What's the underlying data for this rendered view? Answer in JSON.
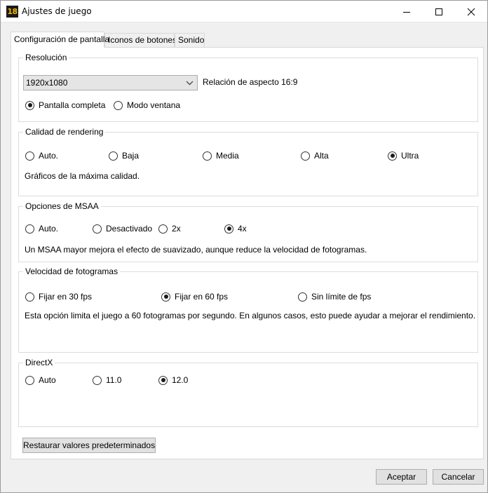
{
  "window": {
    "app_icon_text": "18",
    "title": "Ajustes de juego"
  },
  "tabs": [
    {
      "label": "Configuración de pantalla",
      "active": true
    },
    {
      "label": "Iconos de botones",
      "active": false
    },
    {
      "label": "Sonido",
      "active": false
    }
  ],
  "resolution": {
    "title": "Resolución",
    "selected": "1920x1080",
    "aspect_label": "Relación de aspecto 16:9",
    "modes": [
      {
        "label": "Pantalla completa",
        "checked": true
      },
      {
        "label": "Modo ventana",
        "checked": false
      }
    ]
  },
  "rendering": {
    "title": "Calidad de rendering",
    "options": [
      {
        "label": "Auto.",
        "checked": false
      },
      {
        "label": "Baja",
        "checked": false
      },
      {
        "label": "Media",
        "checked": false
      },
      {
        "label": "Alta",
        "checked": false
      },
      {
        "label": "Ultra",
        "checked": true
      }
    ],
    "description": "Gráficos de la máxima calidad."
  },
  "msaa": {
    "title": "Opciones de MSAA",
    "options": [
      {
        "label": "Auto.",
        "checked": false
      },
      {
        "label": "Desactivado",
        "checked": false
      },
      {
        "label": "2x",
        "checked": false
      },
      {
        "label": "4x",
        "checked": true
      }
    ],
    "description": "Un MSAA mayor mejora el efecto de suavizado, aunque reduce la velocidad de fotogramas."
  },
  "framerate": {
    "title": "Velocidad de fotogramas",
    "options": [
      {
        "label": "Fijar en 30 fps",
        "checked": false
      },
      {
        "label": "Fijar en 60 fps",
        "checked": true
      },
      {
        "label": "Sin límite de fps",
        "checked": false
      }
    ],
    "description": "Esta opción limita el juego a 60 fotogramas por segundo. En algunos casos, esto puede ayudar a mejorar el rendimiento."
  },
  "directx": {
    "title": "DirectX",
    "options": [
      {
        "label": "Auto",
        "checked": false
      },
      {
        "label": "11.0",
        "checked": false
      },
      {
        "label": "12.0",
        "checked": true
      }
    ]
  },
  "buttons": {
    "restore": "Restaurar valores predeterminados",
    "accept": "Aceptar",
    "cancel": "Cancelar"
  },
  "icons": {
    "minimize": "minimize-icon",
    "maximize": "maximize-icon",
    "close": "close-icon",
    "dropdown": "chevron-down-icon"
  }
}
